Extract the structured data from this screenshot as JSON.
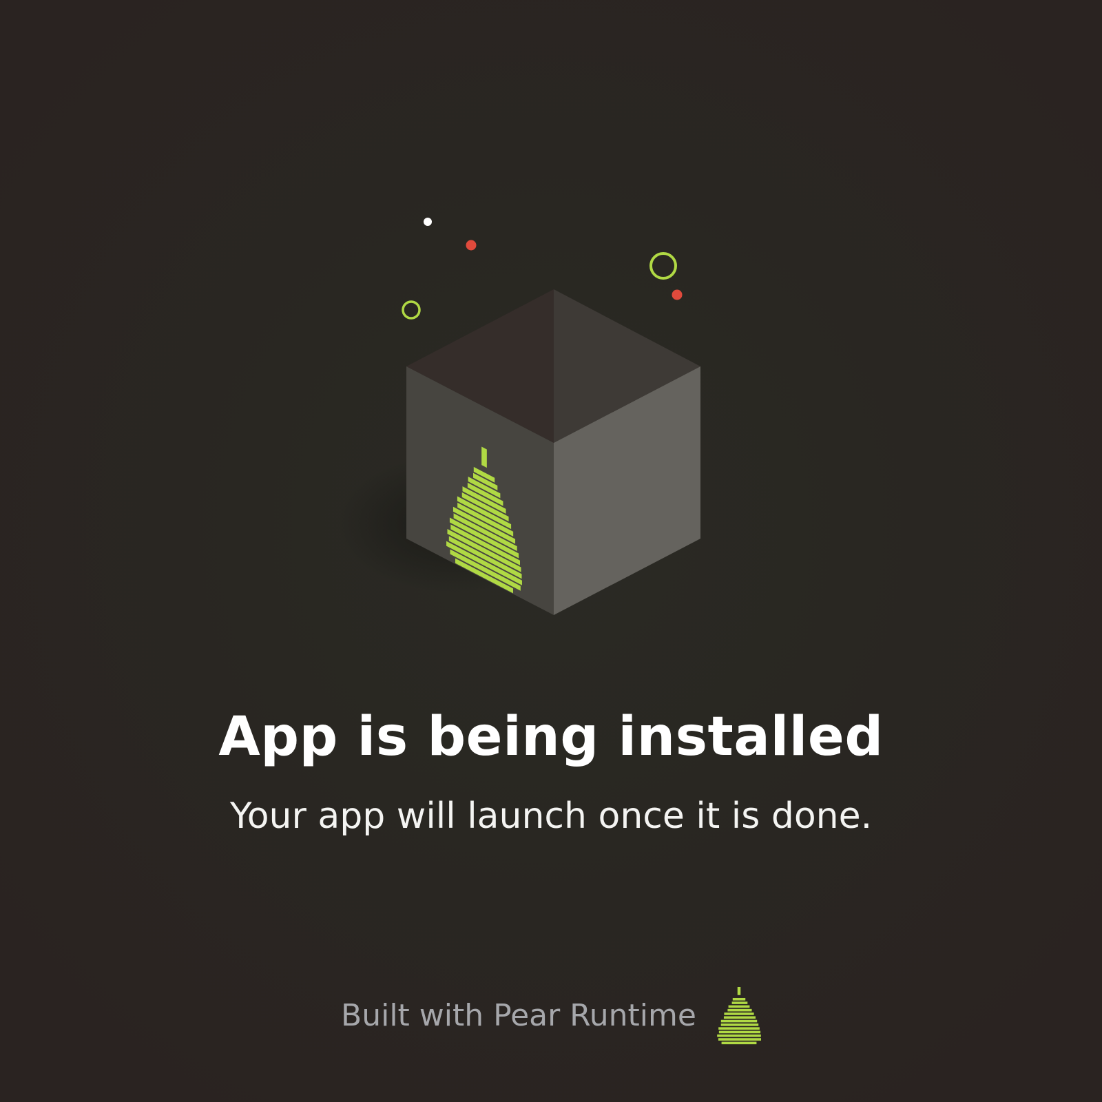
{
  "install_screen": {
    "title": "App is being installed",
    "subtitle": "Your app will launch once it is done."
  },
  "footer": {
    "text": "Built with Pear Runtime",
    "logo_icon": "pear-logo-icon"
  },
  "illustration": {
    "box_icon": "package-box-icon",
    "emblem_icon": "pear-logo-icon"
  },
  "colors": {
    "accent_green": "#b0d944",
    "accent_red": "#e04a3c",
    "particle_white": "#ffffff",
    "footer_text": "#a6a7ab"
  }
}
